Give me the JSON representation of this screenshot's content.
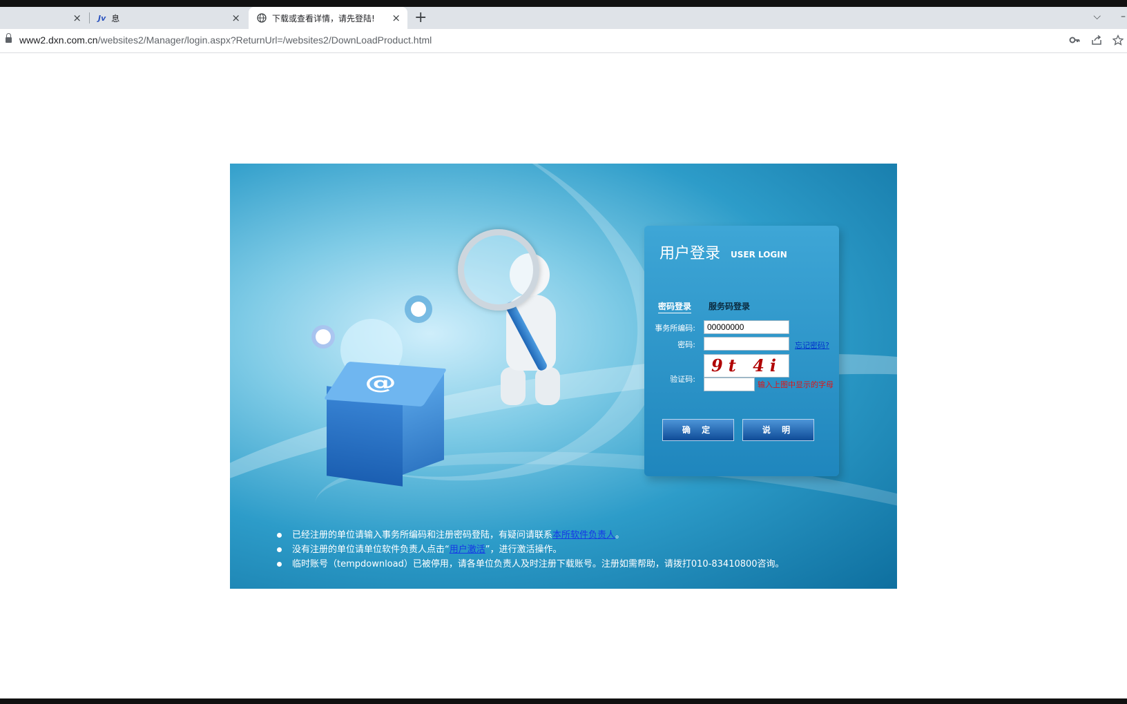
{
  "browser": {
    "tabs": [
      {
        "title": "",
        "active": false
      },
      {
        "title": "息",
        "active": false
      },
      {
        "title": "下载或查看详情，请先登陆!",
        "active": true
      }
    ],
    "new_tab_label": "+",
    "close_label": "×",
    "url_host": "www2.dxn.com.cn",
    "url_path": "/websites2/Manager/login.aspx?ReturnUrl=/websites2/DownLoadProduct.html",
    "icons": [
      "key-icon",
      "share-icon",
      "star-icon",
      "lock-icon",
      "globe-icon",
      "chevron-down-icon"
    ]
  },
  "login": {
    "title": "用户登录",
    "title_en": "USER LOGIN",
    "tabs": [
      "密码登录",
      "服务码登录"
    ],
    "office_code_label": "事务所编码:",
    "office_code_value": "00000000",
    "password_label": "密码:",
    "password_value": "",
    "forgot_label": "忘记密码?",
    "captcha_text": "9t 4i",
    "captcha_label": "验证码:",
    "captcha_value": "",
    "captcha_hint": "输入上图中显示的字母",
    "confirm_label": "确 定",
    "help_label": "说 明"
  },
  "notes": {
    "line1_pre": "已经注册的单位请输入事务所编码和注册密码登陆，有疑问请联系",
    "line1_link": "本所软件负责人",
    "line1_post": "。",
    "line2_pre": "没有注册的单位请单位软件负责人点击“",
    "line2_link": "用户激活",
    "line2_post": "”，进行激活操作。",
    "line3": "临时账号（tempdownload）已被停用，请各单位负责人及时注册下载账号。注册如需帮助，请拨打010-83410800咨询。"
  },
  "colors": {
    "accent_blue": "#1f86bd",
    "error_red": "#e01515",
    "link_blue": "#1538e6"
  }
}
